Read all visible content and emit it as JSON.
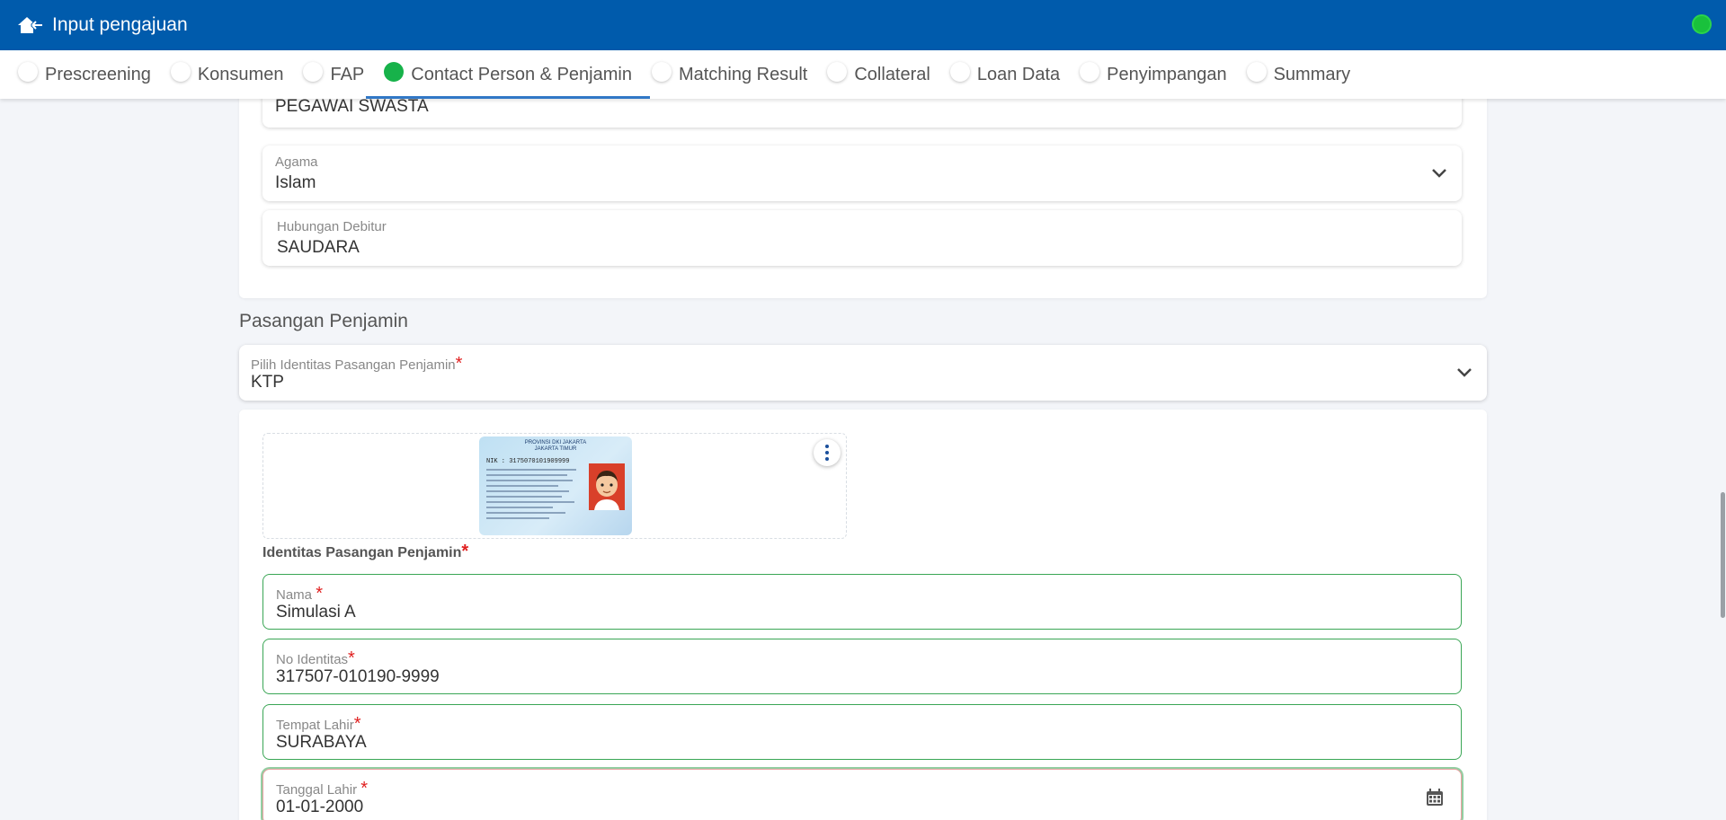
{
  "header": {
    "title": "Input pengajuan",
    "back_icon": "home-back-icon",
    "status_color": "#19c13c"
  },
  "tabs": [
    {
      "label": "Prescreening",
      "active": false
    },
    {
      "label": "Konsumen",
      "active": false
    },
    {
      "label": "FAP",
      "active": false
    },
    {
      "label": "Contact Person & Penjamin",
      "active": true
    },
    {
      "label": "Matching Result",
      "active": false
    },
    {
      "label": "Collateral",
      "active": false
    },
    {
      "label": "Loan Data",
      "active": false
    },
    {
      "label": "Penyimpangan",
      "active": false
    },
    {
      "label": "Summary",
      "active": false
    }
  ],
  "penjamin": {
    "pekerjaan_value": "PEGAWAI SWASTA",
    "agama_label": "Agama",
    "agama_value": "Islam",
    "hubungan_label": "Hubungan Debitur",
    "hubungan_value": "SAUDARA"
  },
  "pasangan": {
    "section_title": "Pasangan Penjamin",
    "identitas_select_label": "Pilih Identitas Pasangan Penjamin",
    "identitas_select_value": "KTP",
    "ktp_card": {
      "province": "PROVINSI DKI JAKARTA",
      "city": "JAKARTA TIMUR",
      "nik": "NIK : 3175070101909999"
    },
    "identitas_label": "Identitas Pasangan Penjamin",
    "nama_label": "Nama",
    "nama_value": "Simulasi A",
    "no_identitas_label": "No Identitas",
    "no_identitas_value": "317507-010190-9999",
    "tempat_lahir_label": "Tempat Lahir",
    "tempat_lahir_value": "SURABAYA",
    "tanggal_lahir_label": "Tanggal Lahir",
    "tanggal_lahir_value": "01-01-2000"
  },
  "required_mark": "*"
}
